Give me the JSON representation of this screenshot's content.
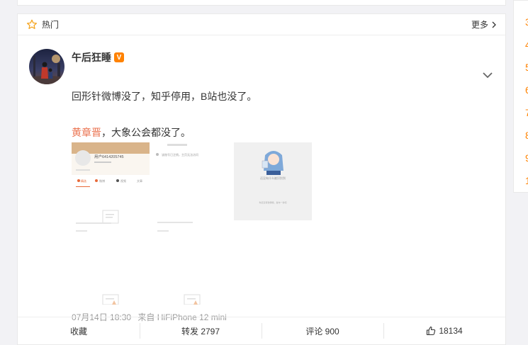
{
  "hot_section": {
    "title": "热门",
    "more_label": "更多"
  },
  "post": {
    "author": "午后狂睡",
    "badge": "V",
    "text_line1": "回形针微博没了，知乎停用，B站也没了。",
    "mention": "黄章晋",
    "text_line2_rest": "，大象公会都没了。",
    "images": {
      "profile_user": "用户6414205745",
      "tab1": "精选",
      "tab2": "微博",
      "tab3": "视频",
      "tab4": "文章",
      "notice": "该账号已注销，主页无法访问",
      "empty_text": "还没有什么被识别到",
      "empty_sub": "你还没有微博哦，发布一条吧"
    },
    "date": "07月14日 18:30",
    "source": "来自 HiFiPhone 12 mini"
  },
  "actions": {
    "favorite": "收藏",
    "repost": "转发 2797",
    "comment": "评论 900",
    "like": "18134"
  },
  "side_numbers": [
    "3",
    "4",
    "5",
    "6",
    "7",
    "8",
    "9",
    "1"
  ],
  "colors": {
    "accent": "#ff8200",
    "mention": "#eb7350",
    "meta": "#999999"
  }
}
